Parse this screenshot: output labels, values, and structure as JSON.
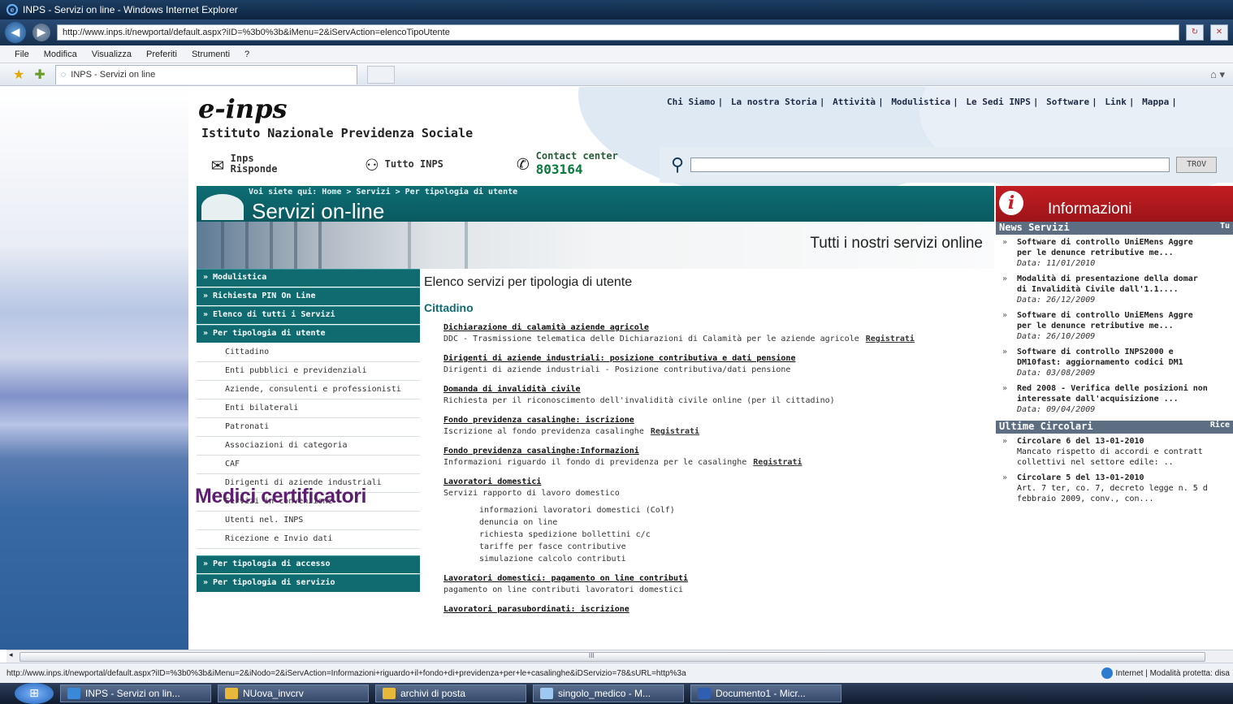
{
  "browser": {
    "window_title": "INPS - Servizi on line - Windows Internet Explorer",
    "url": "http://www.inps.it/newportal/default.aspx?iID=%3b0%3b&iMenu=2&iServAction=elencoTipoUtente",
    "menu": [
      "File",
      "Modifica",
      "Visualizza",
      "Preferiti",
      "Strumenti",
      "?"
    ],
    "tab_title": "INPS - Servizi on line",
    "status_url": "http://www.inps.it/newportal/default.aspx?iID=%3b0%3b&iMenu=2&iNodo=2&iServAction=Informazioni+riguardo+il+fondo+di+previdenza+per+le+casalinghe&iDServizio=78&sURL=http%3a",
    "status_zone": "Internet | Modalità protetta: disa",
    "scroll_marker": "III"
  },
  "header": {
    "logo": "e-inps",
    "institute": "Istituto Nazionale Previdenza Sociale",
    "top_links": [
      "Chi Siamo",
      "La nostra Storia",
      "Attività",
      "Modulistica",
      "Le Sedi INPS",
      "Software",
      "Link",
      "Mappa"
    ],
    "quick": {
      "inps_risponde": "Inps Risponde",
      "tutto_inps": "Tutto INPS",
      "contact_label": "Contact center",
      "contact_number": "803164"
    },
    "search_button": "TROV"
  },
  "services": {
    "breadcrumb": "Voi siete qui: Home > Servizi > Per tipologia di utente",
    "title": "Servizi on-line",
    "banner_text": "Tutti i nostri servizi online"
  },
  "leftnav": {
    "top": [
      "» Modulistica",
      "» Richiesta PIN On Line",
      "» Elenco di tutti i Servizi",
      "» Per tipologia di utente"
    ],
    "sub": [
      "Cittadino",
      "Enti pubblici e previdenziali",
      "Aziende, consulenti e professionisti",
      "Enti bilaterali",
      "Patronati",
      "Associazioni di categoria",
      "CAF",
      "Dirigenti di aziende industriali",
      "Servizi in convenzione",
      "Utenti nel. INPS",
      "Ricezione e Invio dati"
    ],
    "bottom": [
      "» Per tipologia di accesso",
      "» Per tipologia di servizio"
    ],
    "overlay": "Medici certificatori"
  },
  "content": {
    "title": "Elenco servizi per tipologia di utente",
    "subtitle": "Cittadino",
    "services": [
      {
        "title": "Dichiarazione di calamità aziende agricole",
        "desc": "DDC - Trasmissione telematica delle Dichiarazioni di Calamità per le aziende agricole",
        "reg": "Registrati"
      },
      {
        "title": "Dirigenti di aziende industriali: posizione contributiva e dati pensione",
        "desc": "Dirigenti di aziende industriali - Posizione contributiva/dati pensione",
        "reg": ""
      },
      {
        "title": "Domanda di invalidità civile",
        "desc": "Richiesta per il riconoscimento dell'invalidità civile online (per il cittadino)",
        "reg": ""
      },
      {
        "title": "Fondo previdenza casalinghe: iscrizione",
        "desc": "Iscrizione al fondo previdenza casalinghe",
        "reg": "Registrati"
      },
      {
        "title": "Fondo previdenza casalinghe:Informazioni",
        "desc": "Informazioni riguardo il fondo di previdenza per le casalinghe",
        "reg": "Registrati"
      },
      {
        "title": "Lavoratori domestici",
        "desc": "Servizi rapporto di lavoro domestico",
        "reg": "",
        "list": [
          "informazioni lavoratori domestici (Colf)",
          "denuncia on line",
          "richiesta spedizione bollettini c/c",
          "tariffe per fasce contributive",
          "simulazione calcolo contributi"
        ]
      },
      {
        "title": "Lavoratori domestici: pagamento on line contributi",
        "desc": "pagamento on line contributi lavoratori domestici",
        "reg": ""
      },
      {
        "title": "Lavoratori parasubordinati: iscrizione",
        "desc": "",
        "reg": ""
      }
    ]
  },
  "info": {
    "title": "Informazioni",
    "news_title": "News Servizi",
    "news_more": "Tu",
    "news": [
      {
        "t": "Software di controllo UniEMens Aggre",
        "t2": "per le denunce retributive me...",
        "d": "Data: 11/01/2010"
      },
      {
        "t": "Modalità di presentazione della domar",
        "t2": "di Invalidità Civile dall'1.1....",
        "d": "Data: 26/12/2009"
      },
      {
        "t": "Software di controllo UniEMens Aggre",
        "t2": "per le denunce retributive me...",
        "d": "Data: 26/10/2009"
      },
      {
        "t": "Software di controllo INPS2000 e",
        "t2": "DM10fast: aggiornamento codici DM1",
        "d": "Data: 03/08/2009"
      },
      {
        "t": "Red 2008 - Verifica delle posizioni non",
        "t2": "interessate dall'acquisizione ...",
        "d": "Data: 09/04/2009"
      }
    ],
    "circ_title": "Ultime Circolari",
    "circ_more": "Rice",
    "circolari": [
      {
        "t": "Circolare 6 del 13-01-2010",
        "t2": "Mancato rispetto di accordi e contratt",
        "t3": "collettivi nel settore edile: .."
      },
      {
        "t": "Circolare 5 del 13-01-2010",
        "t2": "Art. 7 ter, co. 7, decreto legge n. 5 d",
        "t3": "febbraio 2009, conv., con..."
      }
    ]
  },
  "taskbar": [
    "INPS - Servizi on lin...",
    "NUova_invcrv",
    "archivi di posta",
    "singolo_medico - M...",
    "Documento1 - Micr..."
  ]
}
